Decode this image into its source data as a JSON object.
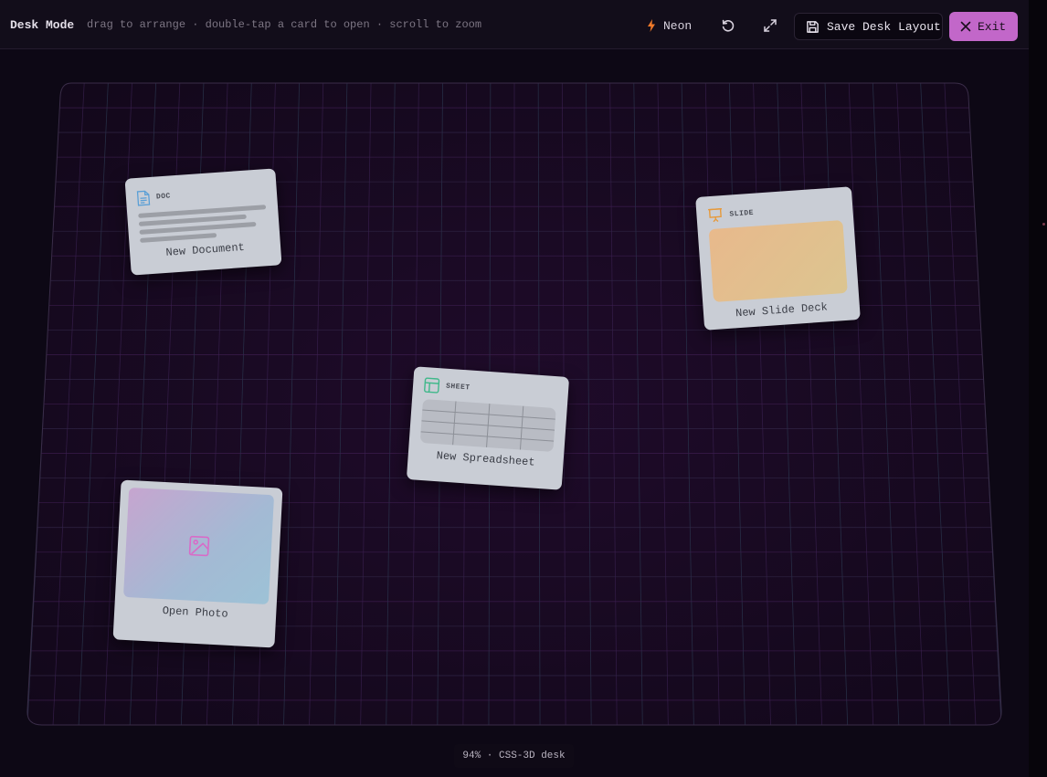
{
  "header": {
    "title": "Desk Mode",
    "hint": "drag to arrange · double-tap a card to open · scroll to zoom",
    "theme_label": "Neon",
    "save_label": "Save Desk Layout",
    "exit_label": "Exit"
  },
  "cards": {
    "doc": {
      "tag": "DOC",
      "label": "New Document"
    },
    "slide": {
      "tag": "SLIDE",
      "label": "New Slide Deck"
    },
    "sheet": {
      "tag": "SHEET",
      "label": "New Spreadsheet"
    },
    "photo": {
      "label": "Open Photo"
    }
  },
  "status": {
    "text": "94% · CSS-3D desk"
  },
  "colors": {
    "accent": "#c267c9",
    "neon_bolt": "#f07a2a",
    "doc_icon": "#5a9fd6",
    "slide_icon": "#e69a3c",
    "sheet_icon": "#3fb88a",
    "photo_icon": "#d86bc8",
    "desk_background": "#14091c"
  }
}
